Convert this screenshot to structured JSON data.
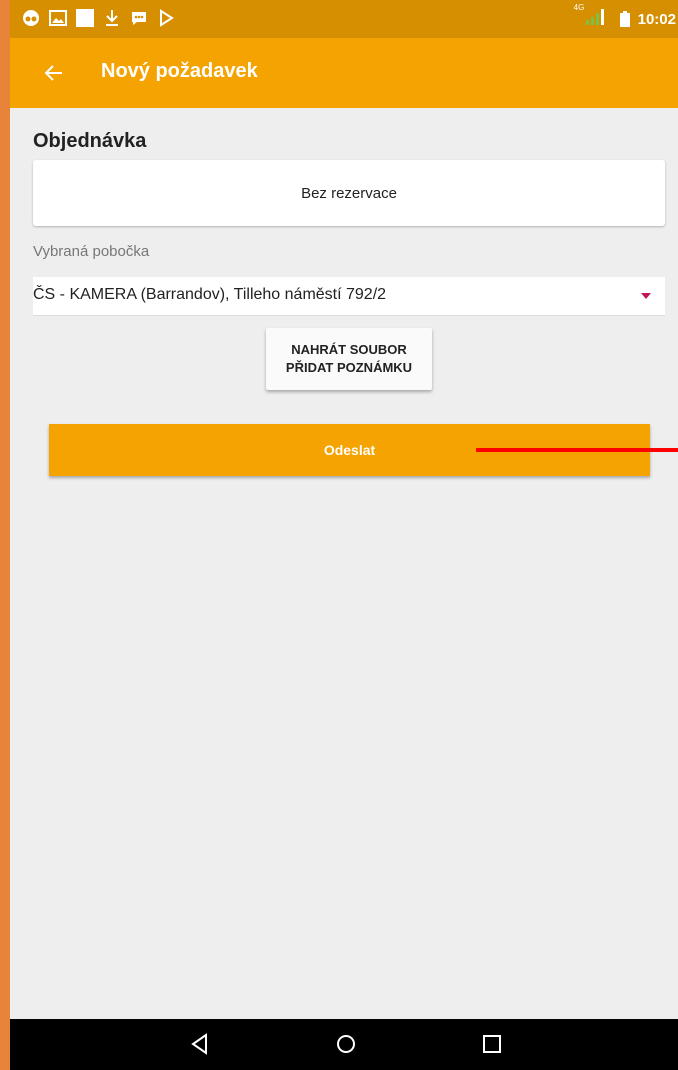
{
  "status_bar": {
    "network_label": "4G",
    "time": "10:02",
    "icons": [
      "camera-app-icon",
      "image-icon",
      "blank-notification-icon",
      "download-icon",
      "message-icon",
      "play-store-icon"
    ]
  },
  "app_bar": {
    "title": "Nový požadavek",
    "back_icon": "arrow-back-icon"
  },
  "order": {
    "section_title": "Objednávka",
    "reservation": "Bez rezervace"
  },
  "branch": {
    "label": "Vybraná pobočka",
    "selected": "ČS - KAMERA (Barrandov), Tilleho náměstí 792/2"
  },
  "upload_button": {
    "line1": "NAHRÁT SOUBOR",
    "line2": "PŘIDAT POZNÁMKU"
  },
  "send_button": {
    "label": "Odeslat"
  },
  "nav_bar": {
    "icons": [
      "back-triangle-icon",
      "home-circle-icon",
      "recents-square-icon"
    ]
  },
  "colors": {
    "status_bar": "#d68f00",
    "app_bar": "#f4a300",
    "accent": "#c2185b",
    "annotation": "#ff0000"
  }
}
